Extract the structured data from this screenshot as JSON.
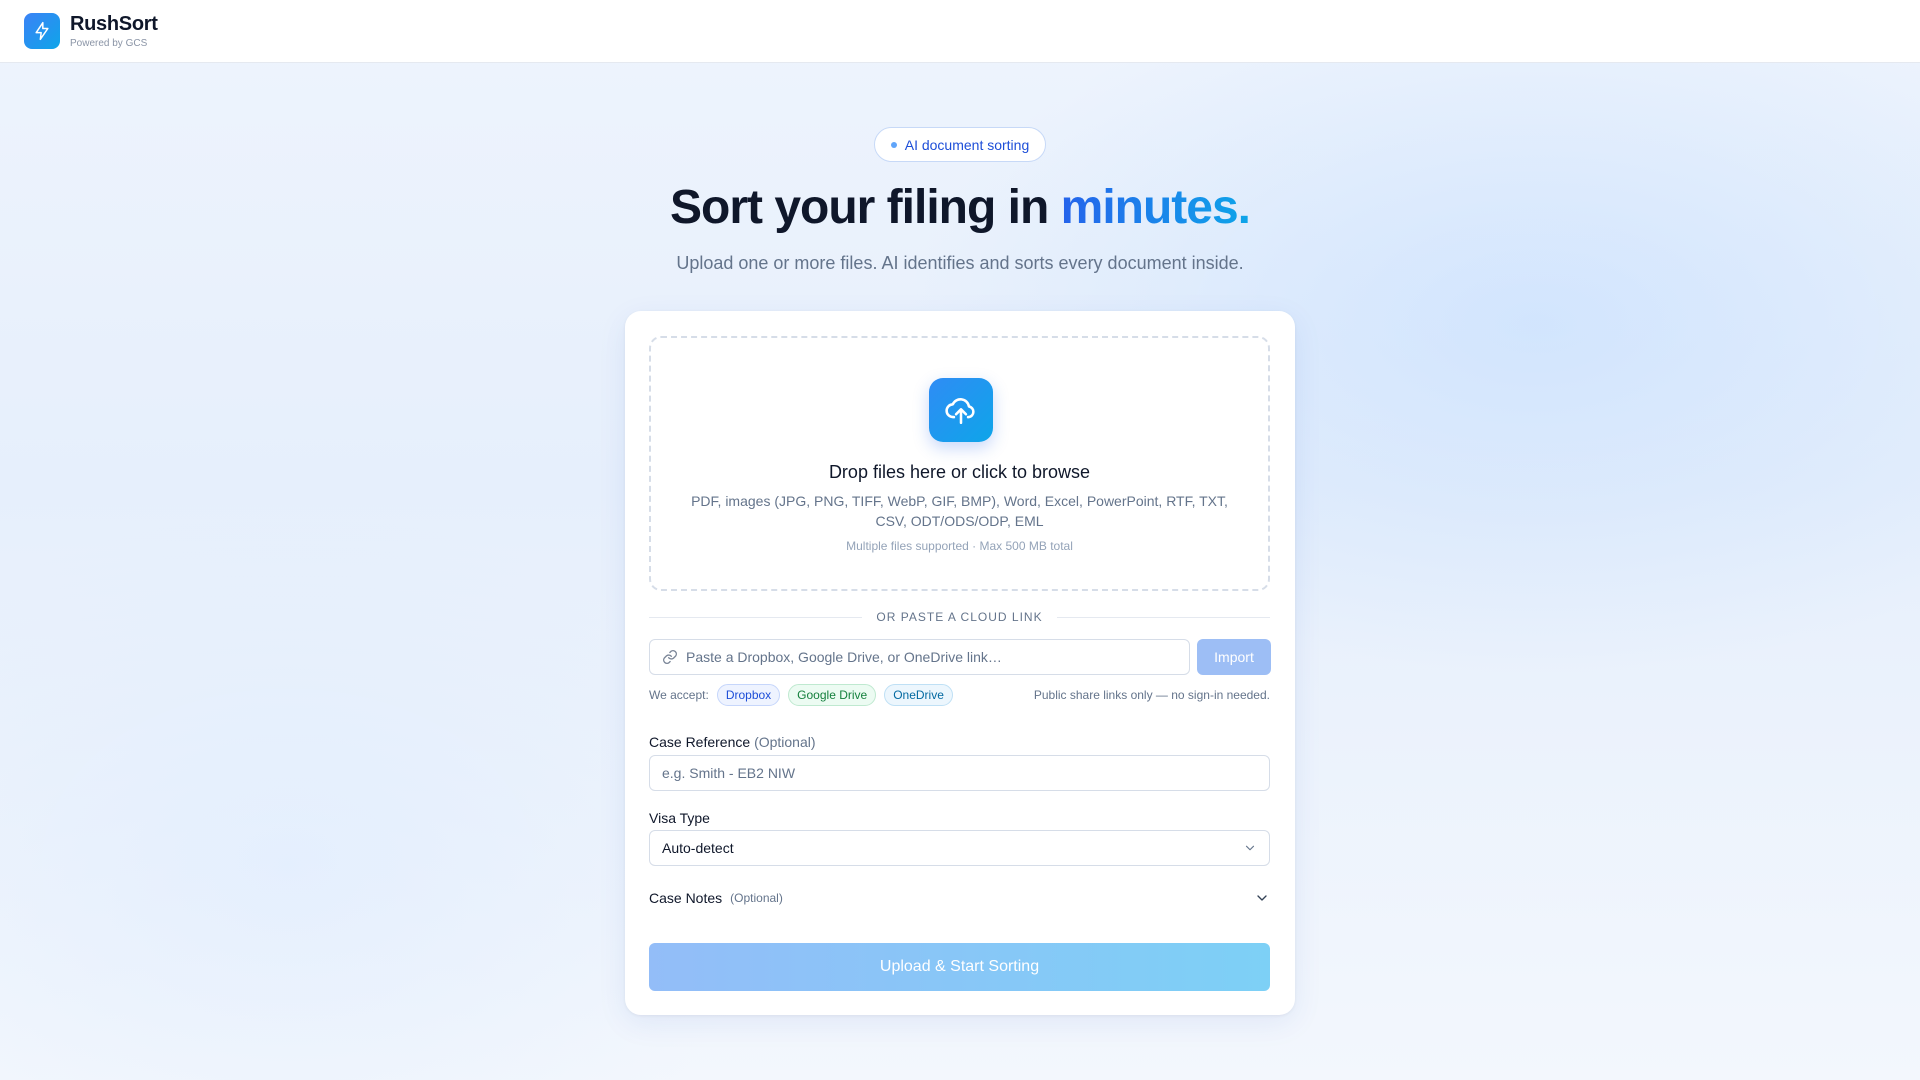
{
  "header": {
    "brand_name": "RushSort",
    "brand_sub": "Powered by GCS",
    "logo_icon": "lightning-bolt-icon"
  },
  "hero": {
    "badge": "AI document sorting",
    "title_main": "Sort your filing in",
    "title_accent": "minutes.",
    "subtitle": "Upload one or more files. AI identifies and sorts every document inside."
  },
  "upload": {
    "icon": "cloud-upload-icon",
    "title": "Drop files here or click to browse",
    "formats": "PDF, images (JPG, PNG, TIFF, WebP, GIF, BMP), Word, Excel, PowerPoint, RTF, TXT, CSV, ODT/ODS/ODP, EML",
    "limit": "Multiple files supported · Max 500 MB total"
  },
  "cloud": {
    "divider": "OR PASTE A CLOUD LINK",
    "placeholder": "Paste a Dropbox, Google Drive, or OneDrive link…",
    "import_label": "Import",
    "accept_label": "We accept:",
    "providers": [
      "Dropbox",
      "Google Drive",
      "OneDrive"
    ],
    "note": "Public share links only — no sign-in needed."
  },
  "case_reference": {
    "label": "Case Reference",
    "optional": "(Optional)",
    "placeholder": "e.g. Smith - EB2 NIW"
  },
  "visa_type": {
    "label": "Visa Type",
    "selected": "Auto-detect"
  },
  "case_notes": {
    "label": "Case Notes",
    "optional": "(Optional)"
  },
  "submit_label": "Upload & Start Sorting",
  "colors": {
    "accent": "#2563eb",
    "accent_light": "#0ea5e9",
    "disabled_button": "#9dbef5"
  }
}
